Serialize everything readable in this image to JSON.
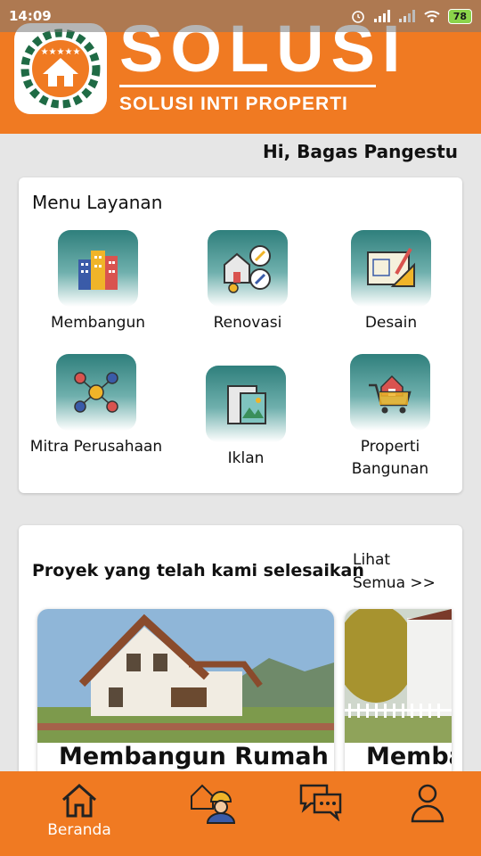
{
  "status_bar": {
    "time": "14:09",
    "battery": "78"
  },
  "brand": {
    "title": "SOLUSI",
    "subtitle": "SOLUSI INTI PROPERTI",
    "logo_icon": "house-gear-logo",
    "color": "#f07a22"
  },
  "greeting": "Hi, Bagas Pangestu",
  "menu": {
    "title": "Menu Layanan",
    "items": [
      {
        "label": "Membangun",
        "icon": "buildings-icon"
      },
      {
        "label": "Renovasi",
        "icon": "renovation-tools-icon"
      },
      {
        "label": "Desain",
        "icon": "blueprint-icon"
      },
      {
        "label": "Mitra Perusahaan",
        "icon": "partners-network-icon"
      },
      {
        "label": "Iklan",
        "icon": "advertisement-icon"
      },
      {
        "label": "Properti Bangunan",
        "icon": "property-cart-icon"
      }
    ]
  },
  "projects": {
    "title": "Proyek yang telah kami selesaikan",
    "see_all": "Lihat Semua >>",
    "items": [
      {
        "caption": "Membangun Rumah"
      },
      {
        "caption": "Membangun Rumah"
      }
    ]
  },
  "bottom_nav": {
    "items": [
      {
        "label": "Beranda",
        "icon": "home-icon"
      },
      {
        "label": "",
        "icon": "worker-icon"
      },
      {
        "label": "",
        "icon": "chat-icon"
      },
      {
        "label": "",
        "icon": "profile-icon"
      }
    ]
  }
}
